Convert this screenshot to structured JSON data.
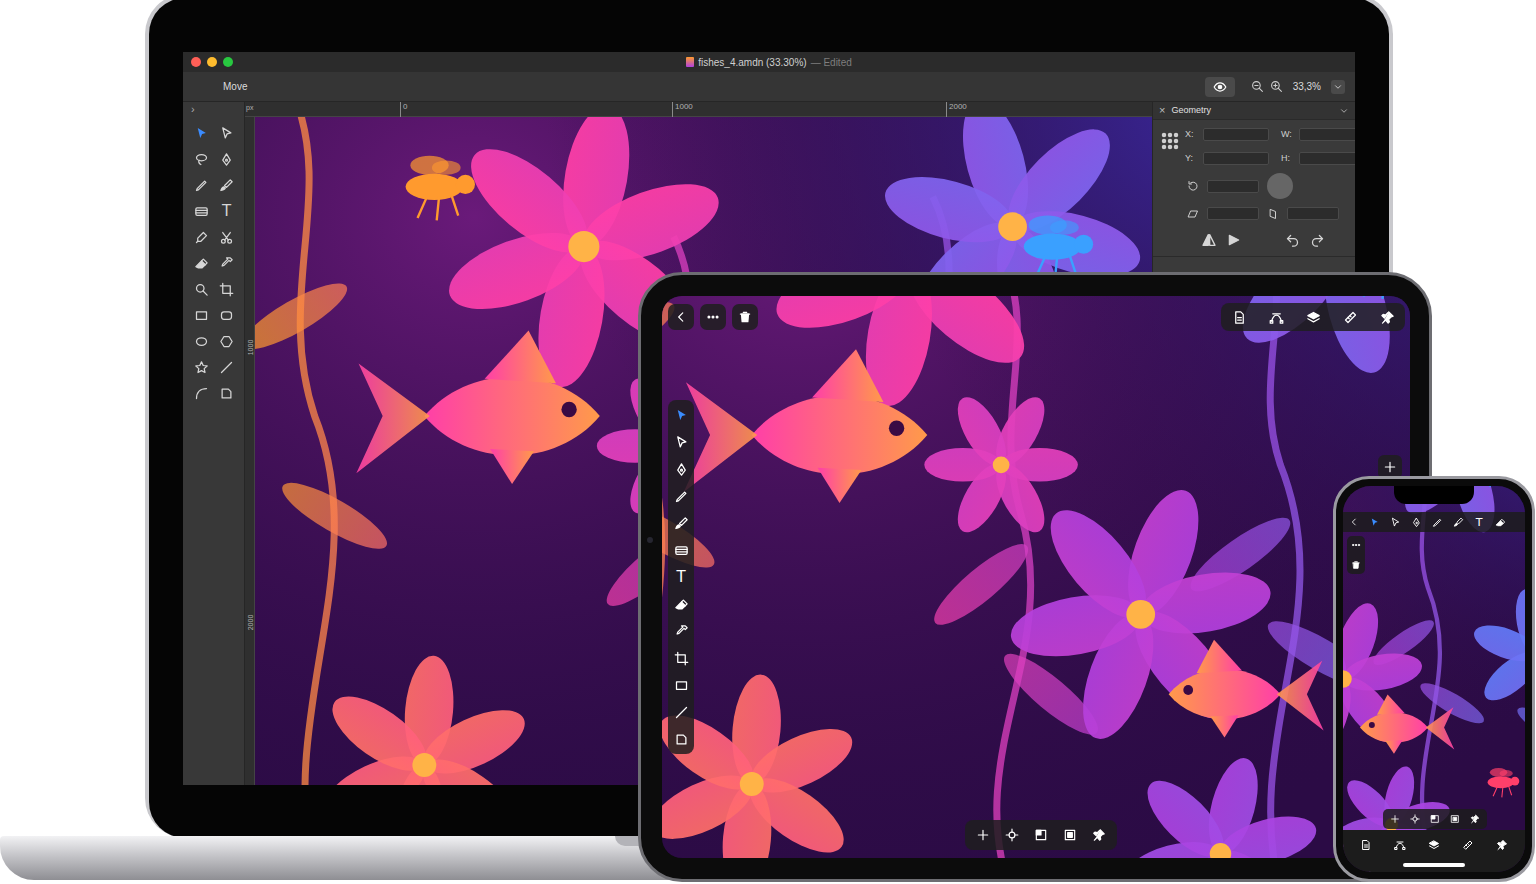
{
  "laptop": {
    "window": {
      "title": "fishes_4.amdn (33.30%)",
      "subtitle": "— Edited"
    },
    "toolbar": {
      "tool": "Move",
      "zoom": "33,3%"
    },
    "ruler": {
      "unit": "px",
      "top": [
        "0",
        "1000",
        "2000"
      ],
      "left": [
        "1000",
        "2000"
      ]
    },
    "collapse": "›",
    "tools": [
      {
        "kind": "arrow",
        "selected": true
      },
      {
        "kind": "direct",
        "selected": false
      },
      {
        "kind": "lasso",
        "selected": false
      },
      {
        "kind": "pen",
        "selected": false
      },
      {
        "kind": "pencil",
        "selected": false
      },
      {
        "kind": "brush",
        "selected": false
      },
      {
        "kind": "gradient",
        "selected": false
      },
      {
        "kind": "text",
        "label": "T",
        "selected": false
      },
      {
        "kind": "eyedropper",
        "selected": false
      },
      {
        "kind": "scissors",
        "selected": false
      },
      {
        "kind": "eraser",
        "selected": false
      },
      {
        "kind": "dropper",
        "selected": false
      },
      {
        "kind": "zoom",
        "selected": false
      },
      {
        "kind": "crop",
        "selected": false
      },
      {
        "kind": "rect",
        "selected": false
      },
      {
        "kind": "rrect",
        "selected": false
      },
      {
        "kind": "ellipse",
        "selected": false
      },
      {
        "kind": "polygon",
        "selected": false
      },
      {
        "kind": "star",
        "selected": false
      },
      {
        "kind": "line",
        "selected": false
      },
      {
        "kind": "arc",
        "selected": false
      },
      {
        "kind": "shape",
        "selected": false
      }
    ],
    "inspector": {
      "close": "×",
      "title": "Geometry",
      "fields": [
        {
          "label": "X:"
        },
        {
          "label": "W:"
        },
        {
          "label": "Y:"
        },
        {
          "label": "H:"
        }
      ]
    }
  },
  "tablet": {
    "top_left": [
      {
        "kind": "back"
      },
      {
        "kind": "more"
      },
      {
        "kind": "trash"
      }
    ],
    "top_right": [
      {
        "kind": "doc"
      },
      {
        "kind": "curve"
      },
      {
        "kind": "layers"
      },
      {
        "kind": "ruler"
      },
      {
        "kind": "pin"
      }
    ],
    "tools": [
      {
        "kind": "arrow",
        "selected": true
      },
      {
        "kind": "direct",
        "selected": false
      },
      {
        "kind": "pen",
        "selected": false
      },
      {
        "kind": "pencil",
        "selected": false
      },
      {
        "kind": "brush",
        "selected": false
      },
      {
        "kind": "gradient",
        "selected": false
      },
      {
        "kind": "text",
        "label": "T",
        "selected": false
      },
      {
        "kind": "eraser",
        "selected": false
      },
      {
        "kind": "dropper",
        "selected": false
      },
      {
        "kind": "crop",
        "selected": false
      },
      {
        "kind": "rect",
        "selected": false
      },
      {
        "kind": "line",
        "selected": false
      },
      {
        "kind": "shape",
        "selected": false
      }
    ],
    "bottom": [
      {
        "kind": "plus"
      },
      {
        "kind": "target"
      },
      {
        "kind": "squaretl"
      },
      {
        "kind": "squarec"
      },
      {
        "kind": "pin"
      }
    ]
  },
  "phone": {
    "tools": [
      {
        "kind": "arrow",
        "selected": true
      },
      {
        "kind": "direct",
        "selected": false
      },
      {
        "kind": "pen",
        "selected": false
      },
      {
        "kind": "pencil",
        "selected": false
      },
      {
        "kind": "brush",
        "selected": false
      },
      {
        "kind": "text",
        "label": "T",
        "selected": false
      },
      {
        "kind": "eraser",
        "selected": false
      }
    ],
    "side": [
      {
        "kind": "more"
      },
      {
        "kind": "trash"
      }
    ],
    "bottom": [
      {
        "kind": "plus"
      },
      {
        "kind": "target"
      },
      {
        "kind": "squaretl"
      },
      {
        "kind": "squarec"
      },
      {
        "kind": "pin"
      }
    ],
    "dock": [
      {
        "kind": "doc"
      },
      {
        "kind": "curve"
      },
      {
        "kind": "layers"
      },
      {
        "kind": "ruler"
      },
      {
        "kind": "pin"
      }
    ]
  }
}
